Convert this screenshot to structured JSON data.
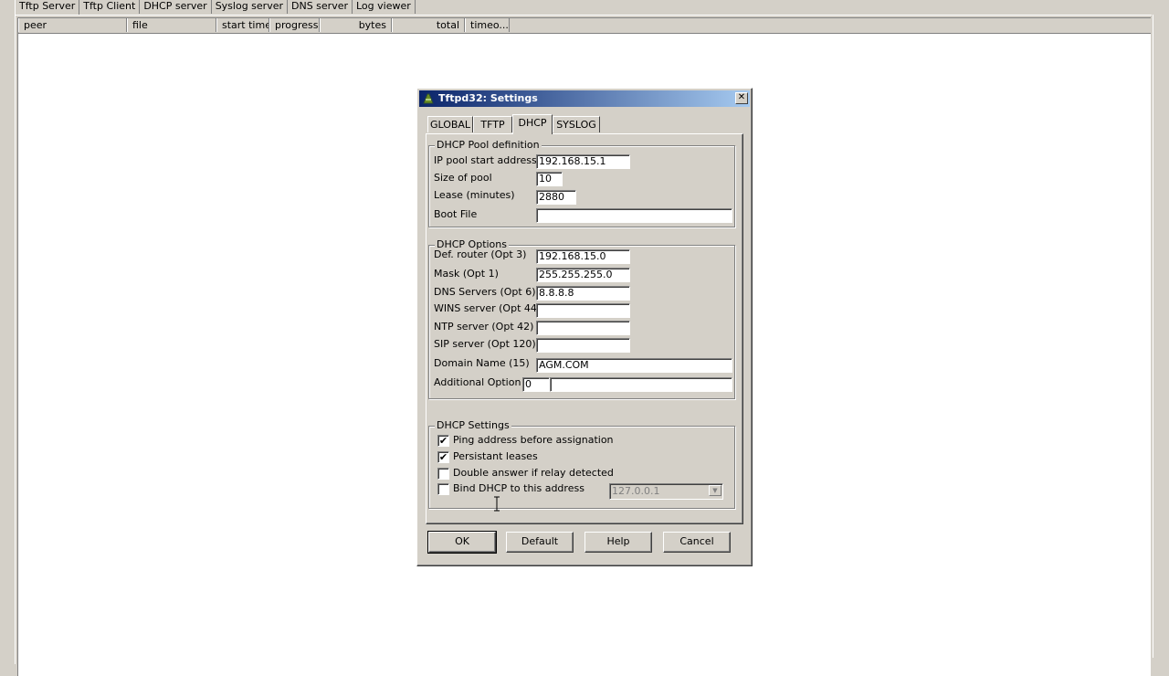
{
  "main": {
    "tabs": [
      "Tftp Server",
      "Tftp Client",
      "DHCP server",
      "Syslog server",
      "DNS server",
      "Log viewer"
    ],
    "columns": [
      "peer",
      "file",
      "start time",
      "progress",
      "bytes",
      "total",
      "timeo..."
    ]
  },
  "dialog": {
    "title": "Tftpd32: Settings",
    "close_label": "✕",
    "tabs": [
      "GLOBAL",
      "TFTP",
      "DHCP",
      "SYSLOG"
    ],
    "active_tab": "DHCP",
    "pool": {
      "group_label": "DHCP Pool definition",
      "start_label": "IP pool start address",
      "start_value": "192.168.15.1",
      "size_label": "Size of pool",
      "size_value": "10",
      "lease_label": "Lease (minutes)",
      "lease_value": "2880",
      "boot_label": "Boot File",
      "boot_value": ""
    },
    "options": {
      "group_label": "DHCP Options",
      "router_label": "Def. router (Opt 3)",
      "router_value": "192.168.15.0",
      "mask_label": "Mask (Opt 1)",
      "mask_value": "255.255.255.0",
      "dns_label": "DNS Servers (Opt 6)",
      "dns_value": "8.8.8.8",
      "wins_label": "WINS server (Opt 44)",
      "wins_value": "",
      "ntp_label": "NTP server (Opt 42)",
      "ntp_value": "",
      "sip_label": "SIP server (Opt 120)",
      "sip_value": "",
      "domain_label": "Domain Name (15)",
      "domain_value": "AGM.COM",
      "additional_label": "Additional Option",
      "additional_num": "0",
      "additional_value": ""
    },
    "settings": {
      "group_label": "DHCP Settings",
      "ping_label": "Ping address before assignation",
      "ping_checked": true,
      "persist_label": "Persistant leases",
      "persist_checked": true,
      "double_label": "Double answer if relay detected",
      "double_checked": false,
      "bind_label": "Bind DHCP to this address",
      "bind_checked": false,
      "bind_address": "127.0.0.1"
    },
    "buttons": {
      "ok": "OK",
      "default": "Default",
      "help": "Help",
      "cancel": "Cancel"
    },
    "check_glyph": "✔",
    "dropdown_glyph": "▼"
  },
  "colors": {
    "face": "#d4d0c8",
    "title_start": "#0a246a",
    "title_end": "#a6caf0"
  }
}
